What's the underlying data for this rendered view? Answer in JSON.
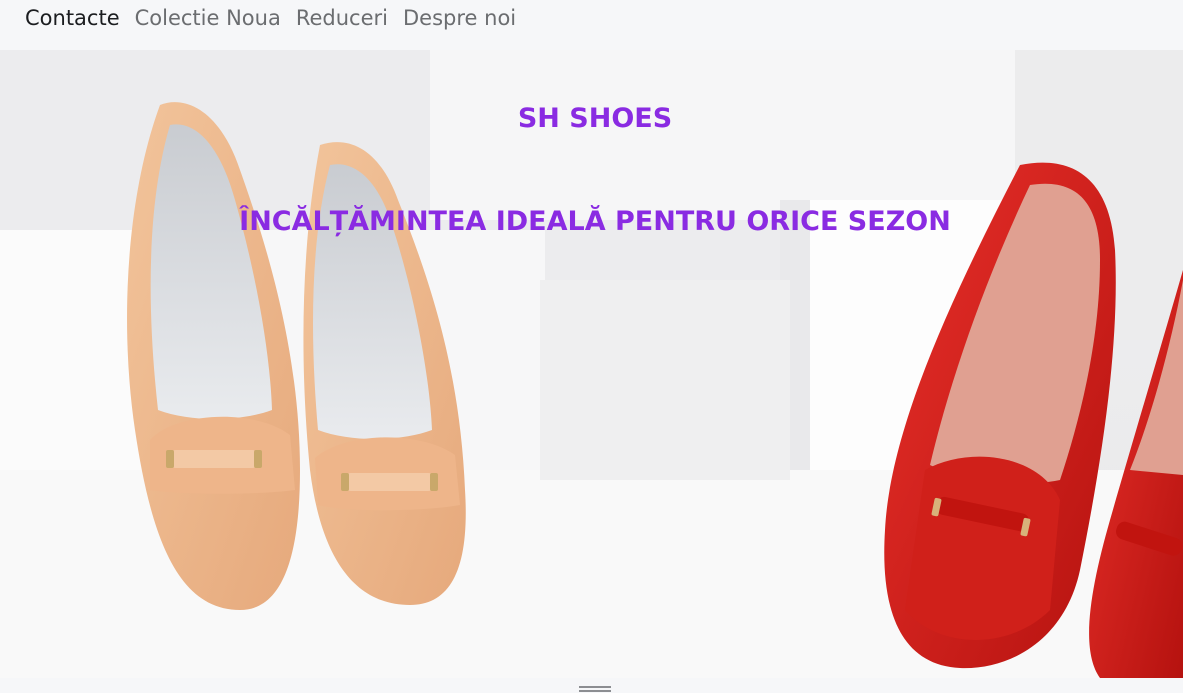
{
  "nav": {
    "items": [
      {
        "label": "Contacte",
        "active": true
      },
      {
        "label": "Colectie Noua",
        "active": false
      },
      {
        "label": "Reduceri",
        "active": false
      },
      {
        "label": "Despre noi",
        "active": false
      }
    ]
  },
  "hero": {
    "brand": "SH SHOES",
    "tagline": "ÎNCĂLȚĂMINTEA IDEALĂ PENTRU ORICE SEZON",
    "accent_color": "#8a2be2",
    "image": "beige and red leather loafers on white display boxes"
  },
  "footer": {
    "handle_icon": "menu-icon"
  }
}
